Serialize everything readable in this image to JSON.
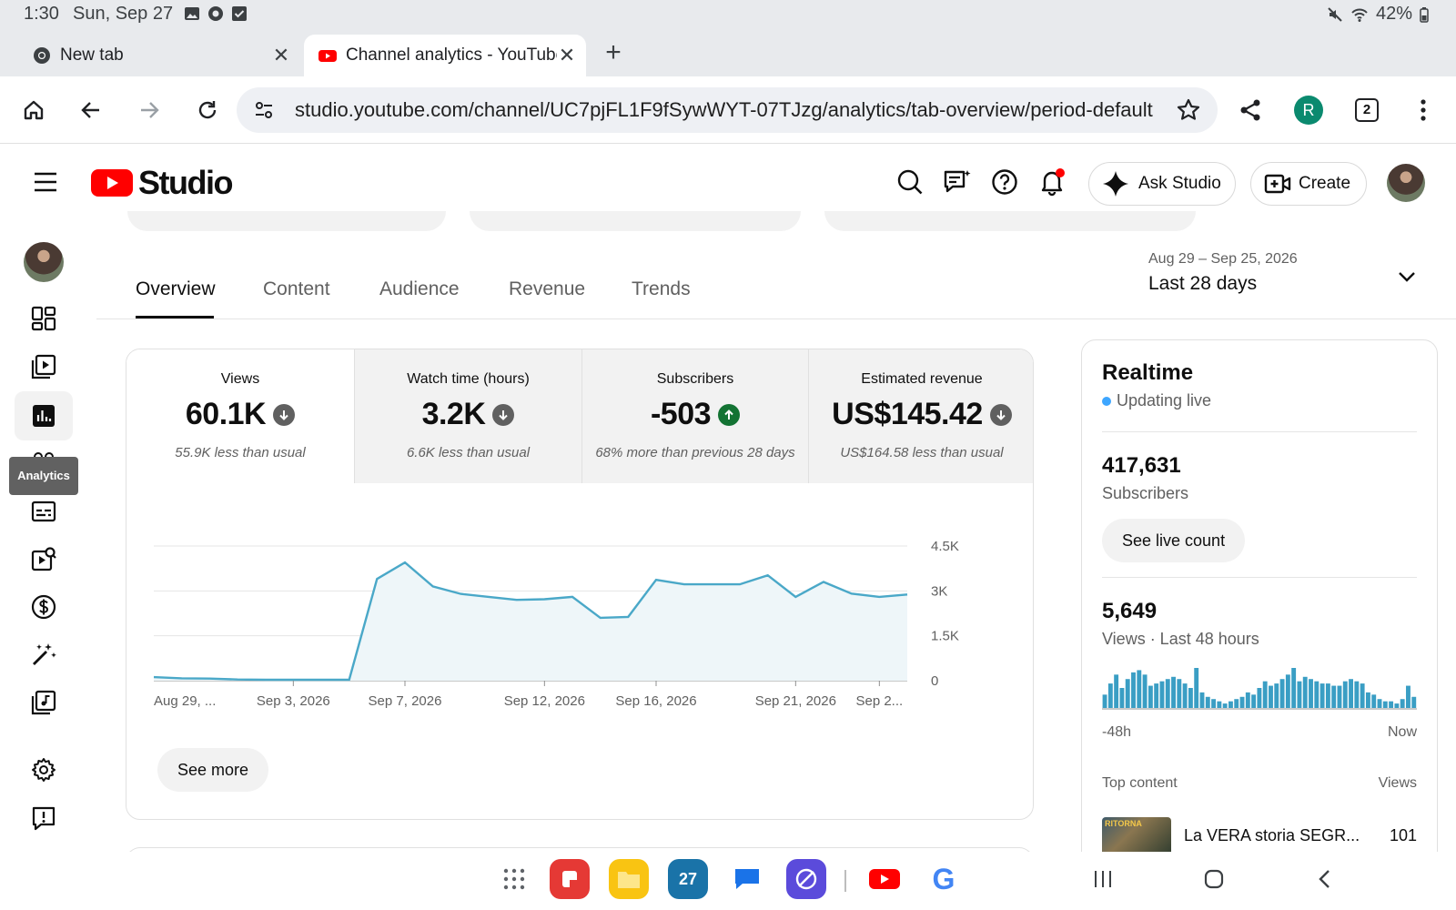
{
  "status_bar": {
    "time": "1:30",
    "date": "Sun, Sep 27",
    "battery": "42%"
  },
  "browser": {
    "tabs": [
      {
        "label": "New tab"
      },
      {
        "label": "Channel analytics - YouTube"
      }
    ],
    "url": "studio.youtube.com/channel/UC7pjFL1F9fSywWYT-07TJzg/analytics/tab-overview/period-default",
    "profile_initial": "R",
    "tab_count": "2"
  },
  "studio": {
    "brand": "Studio",
    "ask_label": "Ask Studio",
    "create_label": "Create"
  },
  "nav": {
    "tooltip": "Analytics"
  },
  "analytics_tabs": [
    "Overview",
    "Content",
    "Audience",
    "Revenue",
    "Trends"
  ],
  "date_range": {
    "range": "Aug 29 – Sep 25, 2026",
    "label": "Last 28 days"
  },
  "metrics": [
    {
      "label": "Views",
      "value": "60.1K",
      "trend": "down",
      "sub": "55.9K less than usual"
    },
    {
      "label": "Watch time (hours)",
      "value": "3.2K",
      "trend": "down",
      "sub": "6.6K less than usual"
    },
    {
      "label": "Subscribers",
      "value": "-503",
      "trend": "up",
      "sub": "68% more than previous 28 days"
    },
    {
      "label": "Estimated revenue",
      "value": "US$145.42",
      "trend": "down",
      "sub": "US$164.58 less than usual"
    }
  ],
  "see_more": "See more",
  "chart_data": {
    "type": "area",
    "x": [
      "Aug 29",
      "Aug 30",
      "Aug 31",
      "Sep 1",
      "Sep 2",
      "Sep 3",
      "Sep 4",
      "Sep 5",
      "Sep 6",
      "Sep 7",
      "Sep 8",
      "Sep 9",
      "Sep 10",
      "Sep 11",
      "Sep 12",
      "Sep 13",
      "Sep 14",
      "Sep 15",
      "Sep 16",
      "Sep 17",
      "Sep 18",
      "Sep 19",
      "Sep 20",
      "Sep 21",
      "Sep 22",
      "Sep 23",
      "Sep 24",
      "Sep 25"
    ],
    "values": [
      120,
      80,
      70,
      40,
      30,
      30,
      30,
      30,
      3400,
      3950,
      3150,
      2900,
      2800,
      2700,
      2720,
      2800,
      2100,
      2130,
      3370,
      3220,
      3220,
      3220,
      3520,
      2800,
      3300,
      2910,
      2800,
      2880
    ],
    "x_tick_labels": [
      "Aug 29, ...",
      "Sep 3, 2026",
      "Sep 7, 2026",
      "Sep 12, 2026",
      "Sep 16, 2026",
      "Sep 21, 2026",
      "Sep 2..."
    ],
    "x_tick_index": [
      0,
      5,
      9,
      14,
      18,
      23,
      26
    ],
    "y_tick_labels": [
      "4.5K",
      "3K",
      "1.5K",
      "0"
    ],
    "ylim": [
      0,
      4500
    ],
    "grid": true,
    "colors": {
      "line": "#4aa8c8",
      "fill": "#eef6f9",
      "grid": "#e5e5e5"
    }
  },
  "realtime": {
    "title": "Realtime",
    "live_label": "Updating live",
    "subscribers_value": "417,631",
    "subscribers_label": "Subscribers",
    "see_live_label": "See live count",
    "views_value": "5,649",
    "views_label": "Views · Last 48 hours",
    "bars": [
      12,
      22,
      30,
      18,
      26,
      32,
      34,
      30,
      20,
      22,
      24,
      26,
      28,
      26,
      22,
      18,
      36,
      14,
      10,
      8,
      6,
      4,
      6,
      8,
      10,
      14,
      12,
      18,
      24,
      20,
      22,
      26,
      30,
      36,
      24,
      28,
      26,
      24,
      22,
      22,
      20,
      20,
      24,
      26,
      24,
      22,
      14,
      12,
      8,
      6,
      6,
      4,
      8,
      20,
      10
    ],
    "axis_start": "-48h",
    "axis_end": "Now",
    "top_content_label": "Top content",
    "top_content_views_label": "Views",
    "top_item": {
      "title": "La VERA storia SEGR...",
      "views": "101",
      "thumb_text": "RITORNA"
    }
  },
  "colors": {
    "brand_red": "#ff0000",
    "accent_teal": "#0b8a6f",
    "up_green": "#137333"
  }
}
